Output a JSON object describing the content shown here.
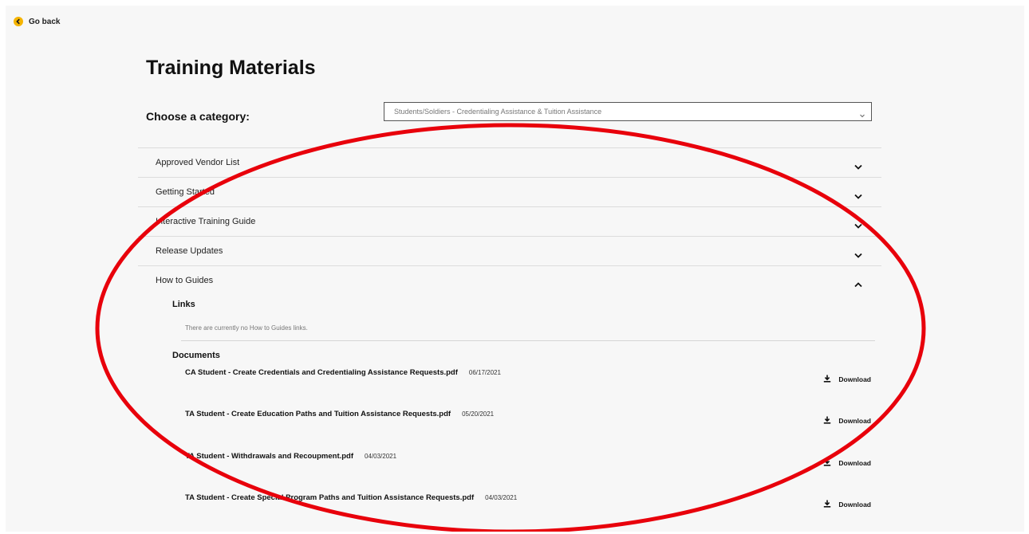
{
  "nav": {
    "go_back": "Go back"
  },
  "page_title": "Training Materials",
  "category": {
    "label": "Choose a category:",
    "selected": "Students/Soldiers - Credentialing Assistance & Tuition Assistance"
  },
  "accordion": {
    "items": [
      {
        "label": "Approved Vendor List",
        "expanded": false
      },
      {
        "label": "Getting Started",
        "expanded": false
      },
      {
        "label": "Interactive Training Guide",
        "expanded": false
      },
      {
        "label": "Release Updates",
        "expanded": false
      },
      {
        "label": "How to Guides",
        "expanded": true
      }
    ],
    "expanded": {
      "links_heading": "Links",
      "links_empty": "There are currently no How to Guides links.",
      "documents_heading": "Documents",
      "documents": [
        {
          "name": "CA Student - Create Credentials and Credentialing Assistance Requests.pdf",
          "date": "06/17/2021",
          "action": "Download"
        },
        {
          "name": "TA Student - Create Education Paths and Tuition Assistance Requests.pdf",
          "date": "05/20/2021",
          "action": "Download"
        },
        {
          "name": "TA Student - Withdrawals and Recoupment.pdf",
          "date": "04/03/2021",
          "action": "Download"
        },
        {
          "name": "TA Student - Create Special Program Paths and Tuition Assistance Requests.pdf",
          "date": "04/03/2021",
          "action": "Download"
        }
      ]
    }
  },
  "colors": {
    "accent": "#f5b400",
    "annotation": "#e8000b"
  },
  "icons": {
    "back": "chevron-left-icon",
    "collapsed": "chevron-down-icon",
    "expanded": "chevron-up-icon",
    "download": "download-icon"
  }
}
